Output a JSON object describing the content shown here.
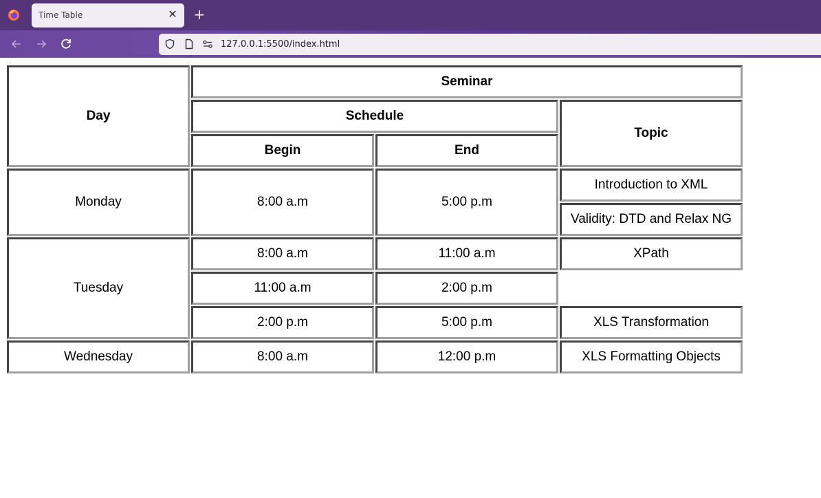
{
  "browser": {
    "tab_title": "Time Table",
    "url": "127.0.0.1:5500/index.html",
    "new_tab_symbol": "+",
    "close_symbol": "✕"
  },
  "table": {
    "headers": {
      "day": "Day",
      "seminar": "Seminar",
      "schedule": "Schedule",
      "topic": "Topic",
      "begin": "Begin",
      "end": "End"
    },
    "monday": {
      "day": "Monday",
      "begin": "8:00 a.m",
      "end": "5:00 p.m",
      "topic_1": "Introduction to XML",
      "topic_2": "Validity: DTD and Relax NG"
    },
    "tuesday": {
      "day": "Tuesday",
      "row1": {
        "begin": "8:00 a.m",
        "end": "11:00 a.m",
        "topic": "XPath"
      },
      "row2": {
        "begin": "11:00 a.m",
        "end": "2:00 p.m"
      },
      "row3": {
        "begin": "2:00 p.m",
        "end": "5:00 p.m",
        "topic": "XLS Transformation"
      }
    },
    "wednesday": {
      "day": "Wednesday",
      "begin": "8:00 a.m",
      "end": "12:00 p.m",
      "topic": "XLS Formatting Objects"
    }
  }
}
